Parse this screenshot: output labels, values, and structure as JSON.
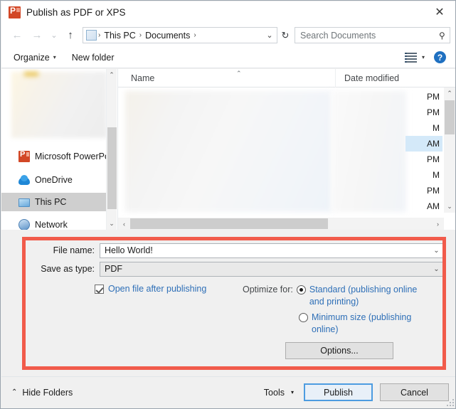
{
  "window": {
    "title": "Publish as PDF or XPS",
    "app_icon": "powerpoint-icon",
    "close_label": "✕"
  },
  "navbar": {
    "back_icon": "←",
    "forward_icon": "→",
    "recent_icon": "⌄",
    "up_icon": "↑",
    "breadcrumb": [
      {
        "label": "This PC",
        "sep": "›"
      },
      {
        "label": "Documents",
        "sep": "›"
      }
    ],
    "breadcrumb_dropdown": "⌄",
    "refresh_icon": "↻",
    "search_placeholder": "Search Documents",
    "search_icon": "⚲"
  },
  "commandbar": {
    "organize_label": "Organize",
    "organize_caret": "▾",
    "new_folder_label": "New folder",
    "view_caret": "▾",
    "help_label": "?"
  },
  "sidebar": {
    "scroll_up": "⌃",
    "scroll_down": "⌄",
    "items": [
      {
        "label": "Microsoft PowerPo",
        "icon": "powerpoint-icon",
        "selected": false
      },
      {
        "label": "OneDrive",
        "icon": "onedrive-cloud-icon",
        "selected": false
      },
      {
        "label": "This PC",
        "icon": "this-pc-icon",
        "selected": true
      },
      {
        "label": "Network",
        "icon": "network-icon",
        "selected": false
      }
    ]
  },
  "filelist": {
    "columns": {
      "name": "Name",
      "date_modified": "Date modified"
    },
    "sort_caret": "⌃",
    "time_fragments": [
      {
        "text": "PM",
        "selected": false
      },
      {
        "text": "PM",
        "selected": false
      },
      {
        "text": "M",
        "selected": false
      },
      {
        "text": "AM",
        "selected": true
      },
      {
        "text": "PM",
        "selected": false
      },
      {
        "text": "M",
        "selected": false
      },
      {
        "text": "PM",
        "selected": false
      },
      {
        "text": "AM",
        "selected": false
      }
    ],
    "vscroll_up": "⌃",
    "vscroll_down": "⌄",
    "hscroll_left": "‹",
    "hscroll_right": "›"
  },
  "form": {
    "file_name_label": "File name:",
    "file_name_value": "Hello World!",
    "file_name_chevron": "⌄",
    "save_as_type_label": "Save as type:",
    "save_as_type_value": "PDF",
    "save_as_type_chevron": "⌄",
    "open_after_publishing_label": "Open file after publishing",
    "open_after_publishing_checked": true,
    "optimize_for_label": "Optimize for:",
    "optimize_standard_label": "Standard (publishing online and printing)",
    "optimize_standard_selected": true,
    "optimize_minimum_label": "Minimum size (publishing online)",
    "optimize_minimum_selected": false,
    "options_button_label": "Options..."
  },
  "bottombar": {
    "hide_folders_caret": "⌃",
    "hide_folders_label": "Hide Folders",
    "tools_label": "Tools",
    "tools_caret": "▾",
    "publish_label": "Publish",
    "cancel_label": "Cancel"
  },
  "highlight": {
    "color": "#f15b4b"
  }
}
